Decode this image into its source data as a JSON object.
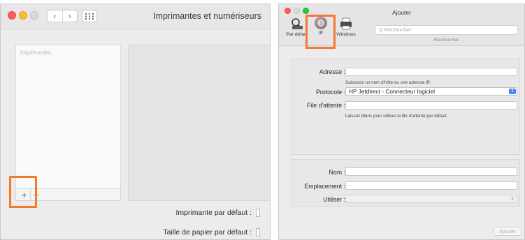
{
  "left_window": {
    "title": "Imprimantes et numériseurs",
    "nav": {
      "back": "‹",
      "forward": "›"
    },
    "printer_list_header": "Imprimantes",
    "add_symbol": "+",
    "remove_symbol": "−",
    "default_printer_label": "Imprimante par défaut :",
    "default_paper_label": "Taille de papier par défaut :"
  },
  "right_window": {
    "title": "Ajouter",
    "toolbar": [
      {
        "label": "Par défaut",
        "icon": "printer-default-icon"
      },
      {
        "label": "IP",
        "icon": "ip-globe-icon"
      },
      {
        "label": "Windows",
        "icon": "windows-printer-icon"
      }
    ],
    "search": {
      "placeholder": "Q Rechercher",
      "caption": "Rechercher"
    },
    "form": {
      "address_label": "Adresse :",
      "address_value": "",
      "address_hint": "Saisissez un nom d'hôte ou une adresse IP.",
      "protocol_label": "Protocole :",
      "protocol_value": "HP Jetdirect - Connecteur logiciel",
      "queue_label": "File d'attente :",
      "queue_value": "",
      "queue_hint": "Laissez blanc pour utiliser la file d'attente par défaut.",
      "name_label": "Nom :",
      "name_value": "",
      "location_label": "Emplacement :",
      "location_value": "",
      "use_label": "Utiliser :",
      "use_value": ""
    },
    "add_button": "Ajouter"
  },
  "colors": {
    "highlight": "#f07a2e",
    "select_accent": "#3b86f7",
    "close": "#fc5f57",
    "minimize": "#fdbc2e",
    "zoom": "#2bc840"
  }
}
